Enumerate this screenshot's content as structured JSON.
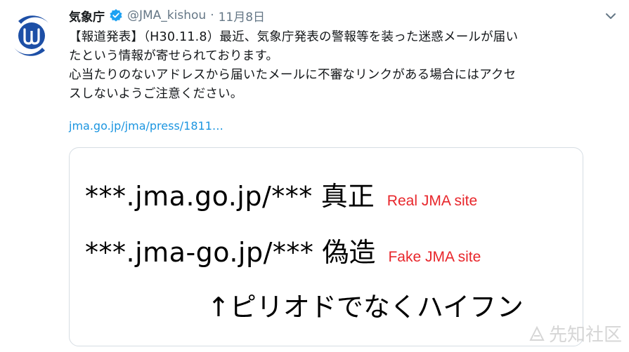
{
  "tweet": {
    "display_name": "気象庁",
    "handle": "@JMA_kishou",
    "separator": "·",
    "date": "11月8日",
    "body_lines": [
      "【報道発表】（H30.11.8）最近、気象庁発表の警報等を装った迷惑メールが届い",
      "たという情報が寄せられております。",
      "心当たりのないアドレスから届いたメールに不審なリンクがある場合にはアクセ",
      "スしないようご注意ください。"
    ],
    "link": "jma.go.jp/jma/press/1811…"
  },
  "card": {
    "real": {
      "url": "***.jma.go.jp/***",
      "label": "真正",
      "note": "Real JMA site"
    },
    "fake": {
      "url": "***.jma-go.jp/***",
      "label": "偽造",
      "note": "Fake JMA site"
    },
    "hint": "↑ピリオドでなくハイフン"
  },
  "watermark": "先知社区",
  "icons": {
    "avatar": "jma-logo-avatar",
    "verified": "verified-badge-icon",
    "menu": "chevron-down-icon"
  },
  "colors": {
    "link": "#1b95e0",
    "verified": "#1da1f2",
    "note": "#e8262b",
    "avatar": "#1d4fa6"
  }
}
